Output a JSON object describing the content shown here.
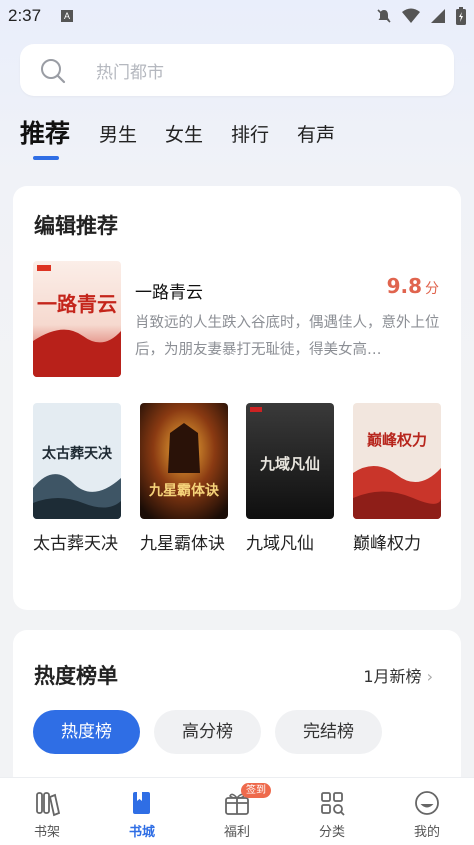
{
  "status_bar": {
    "time": "2:37",
    "a_badge": "A"
  },
  "search": {
    "placeholder": "热门都市"
  },
  "tabs": [
    {
      "label": "推荐",
      "active": true
    },
    {
      "label": "男生"
    },
    {
      "label": "女生"
    },
    {
      "label": "排行"
    },
    {
      "label": "有声"
    }
  ],
  "editor_picks": {
    "title": "编辑推荐",
    "featured": {
      "title": "一路青云",
      "score": "9.8",
      "score_unit": "分",
      "description": "肖致远的人生跌入谷底时，偶遇佳人，意外上位后，为朋友妻暴打无耻徒，得美女高…",
      "cover_text": "一路青云"
    },
    "books": [
      {
        "title": "太古葬天决",
        "cover_text": "太古葬天决",
        "cover_color": "#dfe8ef"
      },
      {
        "title": "九星霸体诀",
        "cover_text": "九星霸体诀",
        "cover_color": "#3a1c12"
      },
      {
        "title": "九域凡仙",
        "cover_text": "九域凡仙",
        "cover_color": "#2a2a2a"
      },
      {
        "title": "巅峰权力",
        "cover_text": "巅峰权力",
        "cover_color": "#efe2d8"
      }
    ]
  },
  "hot_list": {
    "title": "热度榜单",
    "more_label": "1月新榜",
    "chips": [
      {
        "label": "热度榜",
        "active": true
      },
      {
        "label": "高分榜"
      },
      {
        "label": "完结榜"
      }
    ]
  },
  "bottom_nav": [
    {
      "label": "书架",
      "icon": "bookshelf-icon"
    },
    {
      "label": "书城",
      "icon": "bookstore-icon",
      "active": true
    },
    {
      "label": "福利",
      "icon": "gift-icon",
      "badge": "签到"
    },
    {
      "label": "分类",
      "icon": "category-icon"
    },
    {
      "label": "我的",
      "icon": "profile-icon"
    }
  ],
  "colors": {
    "accent": "#2f6ee5",
    "score": "#e0644e",
    "badge": "#ee6a4c"
  }
}
